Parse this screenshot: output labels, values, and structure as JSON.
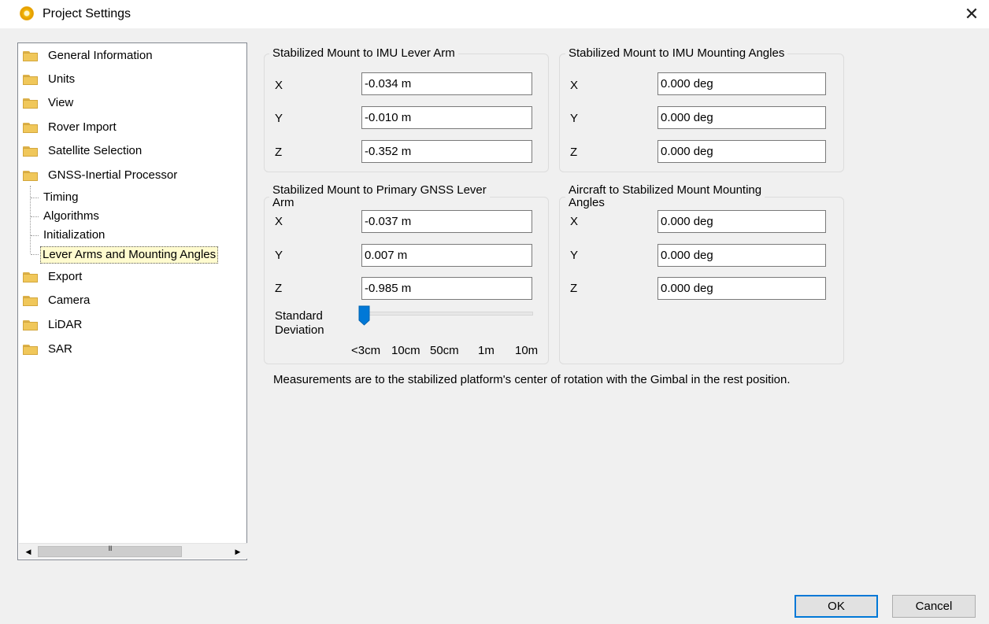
{
  "window": {
    "title": "Project Settings",
    "close_glyph": "✕"
  },
  "tree": {
    "items": [
      {
        "label": "General Information",
        "icon": "folder-icon"
      },
      {
        "label": "Units",
        "icon": "folder-icon"
      },
      {
        "label": "View",
        "icon": "folder-icon"
      },
      {
        "label": "Rover Import",
        "icon": "folder-icon"
      },
      {
        "label": "Satellite Selection",
        "icon": "folder-icon"
      },
      {
        "label": "GNSS-Inertial Processor",
        "icon": "folder-icon"
      },
      {
        "label": "Timing"
      },
      {
        "label": "Algorithms"
      },
      {
        "label": "Initialization"
      },
      {
        "label": "Lever Arms and Mounting Angles",
        "selected": true
      },
      {
        "label": "Export",
        "icon": "folder-icon"
      },
      {
        "label": "Camera",
        "icon": "folder-icon"
      },
      {
        "label": "LiDAR",
        "icon": "folder-icon"
      },
      {
        "label": "SAR",
        "icon": "folder-icon"
      }
    ],
    "scroll_left_glyph": "◀",
    "scroll_right_glyph": "▶",
    "scroll_grip_glyph": "III"
  },
  "imu_lever_arm": {
    "title": "Stabilized Mount to IMU Lever Arm",
    "x_label": "X",
    "y_label": "Y",
    "z_label": "Z",
    "x_value": "-0.034 m",
    "y_value": "-0.010 m",
    "z_value": "-0.352 m"
  },
  "imu_mounting_angles": {
    "title": "Stabilized Mount to IMU Mounting Angles",
    "x_label": "X",
    "y_label": "Y",
    "z_label": "Z",
    "x_value": "0.000 deg",
    "y_value": "0.000 deg",
    "z_value": "0.000 deg"
  },
  "gnss_lever_arm": {
    "title_line1": "Stabilized Mount to Primary GNSS Lever",
    "title_line2": "Arm",
    "x_label": "X",
    "y_label": "Y",
    "z_label": "Z",
    "x_value": "-0.037 m",
    "y_value": "0.007 m",
    "z_value": "-0.985 m",
    "std_dev_label_line1": "Standard",
    "std_dev_label_line2": "Deviation",
    "std_dev_ticks": [
      "<3cm",
      "10cm",
      "50cm",
      "1m",
      "10m"
    ],
    "std_dev_selected_index": 0
  },
  "aircraft_mounting_angles": {
    "title_line1": "Aircraft to Stabilized Mount Mounting",
    "title_line2": "Angles",
    "x_label": "X",
    "y_label": "Y",
    "z_label": "Z",
    "x_value": "0.000 deg",
    "y_value": "0.000 deg",
    "z_value": "0.000 deg"
  },
  "note": "Measurements are to the stabilized platform's center of rotation with the Gimbal in the rest position.",
  "buttons": {
    "ok": "OK",
    "cancel": "Cancel"
  },
  "colors": {
    "accent": "#0078d7",
    "selection_bg": "#fffbcf",
    "folder": "#f0c75a"
  }
}
